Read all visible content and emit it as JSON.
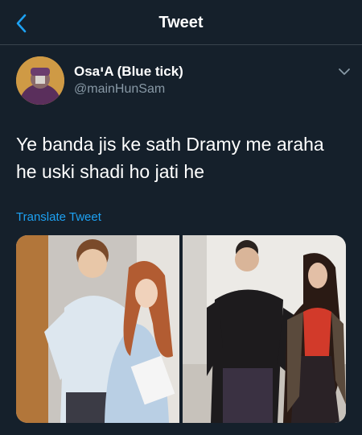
{
  "header": {
    "title": "Tweet"
  },
  "author": {
    "display_name": "OsaיA (Blue tick)",
    "handle": "@mainHunSam"
  },
  "tweet": {
    "text": "Ye banda jis ke sath Dramy me araha he uski shadi ho jati he"
  },
  "actions": {
    "translate_label": "Translate Tweet"
  },
  "media": [
    {
      "icon": "photo"
    },
    {
      "icon": "photo"
    }
  ],
  "colors": {
    "background": "#15202b",
    "accent": "#1da1f2",
    "muted": "#8899a6",
    "divider": "#38444d"
  }
}
